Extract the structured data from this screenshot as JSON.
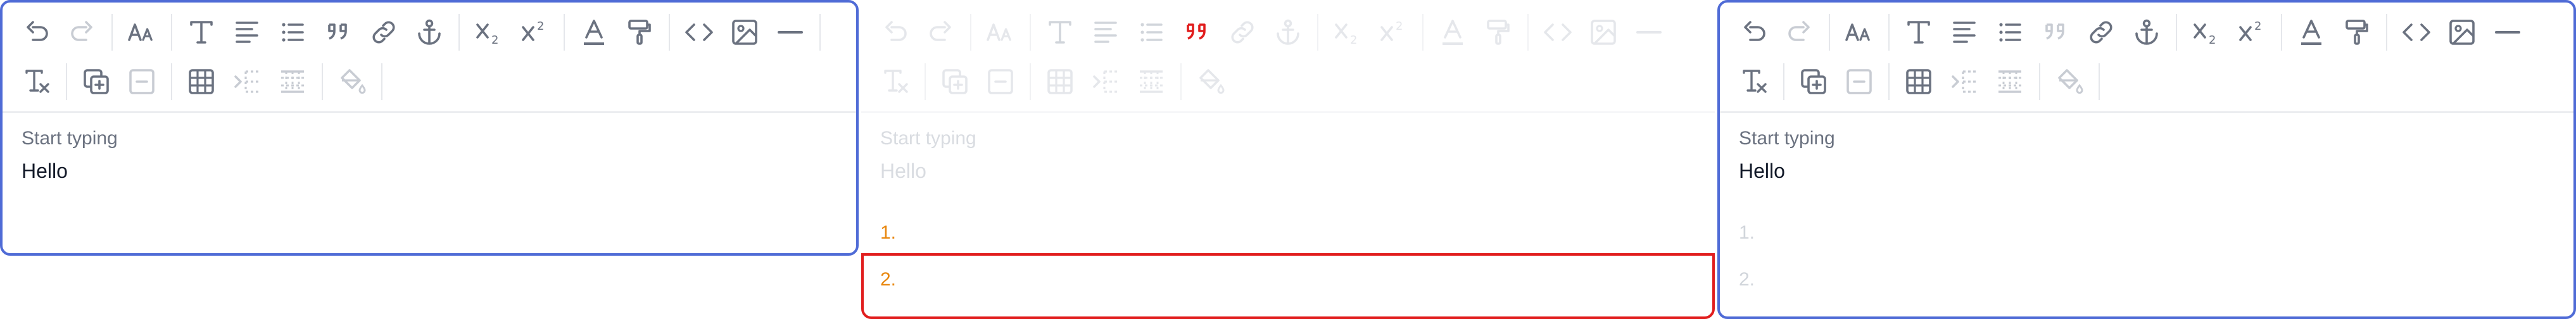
{
  "editors": [
    {
      "placeholder": "Start typing",
      "text": "Hello"
    },
    {
      "placeholder": "Start typing",
      "text": "Hello",
      "list_items": [
        "1.",
        "2."
      ]
    },
    {
      "placeholder": "Start typing",
      "text": "Hello",
      "list_items": [
        "1.",
        "2."
      ]
    }
  ],
  "toolbar_icons": [
    "undo-icon",
    "redo-icon",
    "font-size-icon",
    "heading-icon",
    "align-icon",
    "bulleted-list-icon",
    "blockquote-icon",
    "link-icon",
    "anchor-icon",
    "subscript-icon",
    "superscript-icon",
    "text-color-icon",
    "format-painter-icon",
    "code-icon",
    "image-icon",
    "horizontal-rule-icon",
    "clear-format-icon",
    "insert-block-icon",
    "remove-block-icon",
    "table-icon",
    "indent-icon",
    "table-grid-icon",
    "fill-color-icon"
  ],
  "colors": {
    "focused_border": "#4f6bd6",
    "active_red": "#e11d1d",
    "list_number_orange": "#e8860c"
  }
}
